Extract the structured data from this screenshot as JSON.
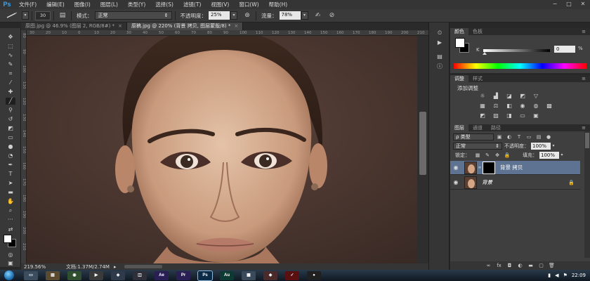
{
  "app": {
    "logo": "Ps"
  },
  "menu": [
    "文件(F)",
    "编辑(E)",
    "图像(I)",
    "图层(L)",
    "类型(Y)",
    "选择(S)",
    "滤镜(T)",
    "视图(V)",
    "窗口(W)",
    "帮助(H)"
  ],
  "window_controls": [
    "−",
    "□",
    "✕"
  ],
  "options": {
    "brush_size": "30",
    "mode_label": "模式：",
    "mode_value": "正常",
    "opacity_label": "不透明度：",
    "opacity_value": "25%",
    "flow_label": "流量：",
    "flow_value": "78%"
  },
  "tabs": [
    {
      "label": "原图.jpg @ 46.9% (图层 2, RGB/8#) *",
      "close": "×",
      "active": false
    },
    {
      "label": "原稿.jpg @ 220% (背景 拷贝, 图层蒙版/8) *",
      "close": "×",
      "active": true
    }
  ],
  "rulers": {
    "top": [
      "30",
      "20",
      "10",
      "0",
      "10",
      "20",
      "30",
      "40",
      "50",
      "60",
      "70",
      "80",
      "90",
      "100",
      "110",
      "120",
      "130",
      "140",
      "150",
      "160",
      "170",
      "180",
      "190",
      "200",
      "210"
    ],
    "left": [
      "80",
      "90",
      "100",
      "110",
      "120",
      "130",
      "140",
      "150",
      "160",
      "170",
      "180",
      "190",
      "200",
      "210"
    ]
  },
  "status": {
    "zoom": "219.56%",
    "doc": "文档:1.37M/2.74M"
  },
  "color_panel": {
    "tabs": [
      "颜色",
      "色板"
    ],
    "channel": "K",
    "value": "0",
    "unit": "%"
  },
  "adjustments_panel": {
    "tabs": [
      "调整",
      "样式"
    ],
    "title": "添加调整"
  },
  "layers_panel": {
    "tabs": [
      "图层",
      "通道",
      "路径"
    ],
    "filter_label": "ρ 类型",
    "blend_mode": "正常",
    "opacity_label": "不透明度：",
    "opacity_value": "100%",
    "lock_label": "锁定：",
    "fill_label": "填充：",
    "fill_value": "100%",
    "layers": [
      {
        "name": "背景 拷贝",
        "selected": true,
        "has_mask": true,
        "italic": false
      },
      {
        "name": "背景",
        "selected": false,
        "has_mask": false,
        "italic": true
      }
    ]
  },
  "taskbar": {
    "apps": [
      "Ae",
      "Pr",
      "Ps",
      "Au"
    ],
    "clock": "22:09",
    "app_colors": {
      "Ae": "#2a1f55",
      "Pr": "#2a1f55",
      "Ps": "#0b2a45",
      "Au": "#0d3b33"
    }
  },
  "colors": {
    "accent_selection": "#5d7391",
    "ps_blue": "#31a8ff"
  }
}
